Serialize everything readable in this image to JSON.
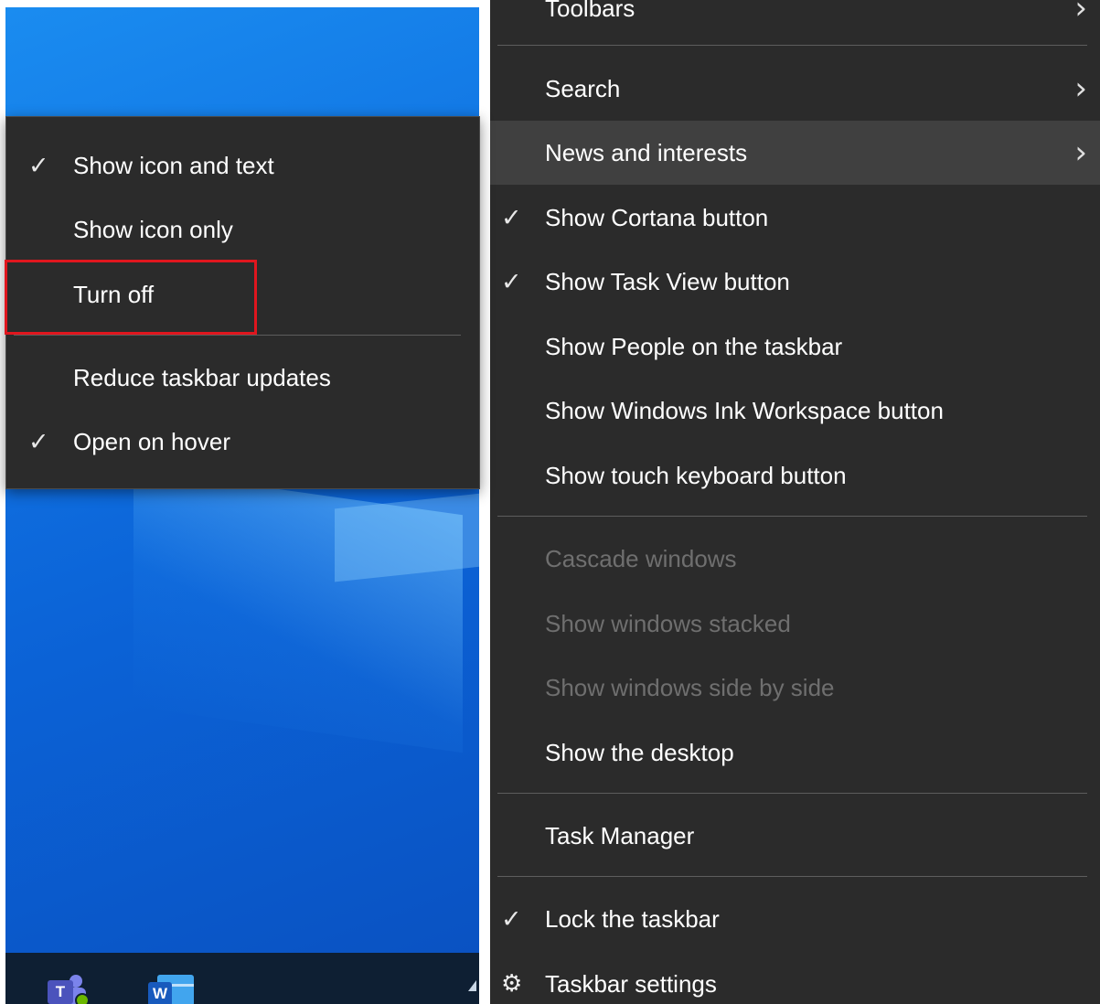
{
  "taskbar_context_menu": {
    "items": [
      {
        "label": "Toolbars",
        "checked": false,
        "submenu": true
      },
      {
        "label": "Search",
        "checked": false,
        "submenu": true
      },
      {
        "label": "News and interests",
        "checked": false,
        "submenu": true,
        "hovered": true
      },
      {
        "label": "Show Cortana button",
        "checked": true
      },
      {
        "label": "Show Task View button",
        "checked": true
      },
      {
        "label": "Show People on the taskbar",
        "checked": false
      },
      {
        "label": "Show Windows Ink Workspace button",
        "checked": false
      },
      {
        "label": "Show touch keyboard button",
        "checked": false
      },
      {
        "label": "Cascade windows",
        "disabled": true
      },
      {
        "label": "Show windows stacked",
        "disabled": true
      },
      {
        "label": "Show windows side by side",
        "disabled": true
      },
      {
        "label": "Show the desktop"
      },
      {
        "label": "Task Manager"
      },
      {
        "label": "Lock the taskbar",
        "checked": true
      },
      {
        "label": "Taskbar settings",
        "icon": "gear-icon"
      }
    ]
  },
  "news_submenu": {
    "items": [
      {
        "label": "Show icon and text",
        "checked": true
      },
      {
        "label": "Show icon only",
        "checked": false
      },
      {
        "label": "Turn off",
        "checked": false,
        "highlighted": true
      },
      {
        "label": "Reduce taskbar updates",
        "checked": false
      },
      {
        "label": "Open on hover",
        "checked": true
      }
    ]
  },
  "glyphs": {
    "check": "✓",
    "chevron": "›",
    "gear": "⚙"
  },
  "taskbar": {
    "teams_letter": "T",
    "word_letter": "W"
  },
  "colors": {
    "menu_bg": "#2b2b2b",
    "menu_hover": "#404040",
    "text": "#ffffff",
    "disabled_text": "#6f6f6f",
    "highlight_box": "#e0161e",
    "wallpaper": "#0b62d6"
  }
}
